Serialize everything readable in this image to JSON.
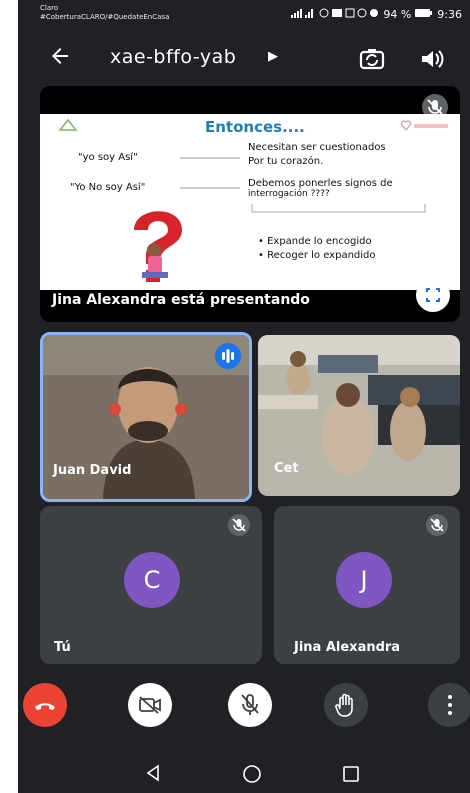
{
  "status": {
    "carrier_line1": "Claro",
    "carrier_line2": "#CoberturaCLARO/#QuedateEnCasa",
    "battery": "94 %",
    "time": "9:36"
  },
  "header": {
    "meeting_code": "xae-bffo-yab",
    "back_icon": "arrow-left-icon",
    "switch_camera_icon": "switch-camera-icon",
    "speaker_icon": "speaker-icon"
  },
  "presentation": {
    "slide_title": "Entonces....",
    "left_line1": "\"yo soy Así\"",
    "left_line2": "\"Yo No soy Así\"",
    "right_line1": "Necesitan ser cuestionados",
    "right_line2": "Por tu corazón.",
    "right_line3": "Debemos ponerles signos de",
    "right_line4": "interrogación ????",
    "bullet1": "• Expande lo encogido",
    "bullet2": "• Recoger lo expandido",
    "presenter_label": "Jina Alexandra está presentando"
  },
  "participants": [
    {
      "name": "Juan David",
      "type": "video",
      "speaking": true
    },
    {
      "name": "Cet",
      "type": "video"
    },
    {
      "name": "Tú",
      "initial": "C",
      "muted": true
    },
    {
      "name": "Jina Alexandra",
      "initial": "J",
      "muted": true
    }
  ],
  "colors": {
    "background": "#202124",
    "avatar": "#7e57c2",
    "hangup": "#ea4335",
    "active_border": "#8ab4f8"
  }
}
